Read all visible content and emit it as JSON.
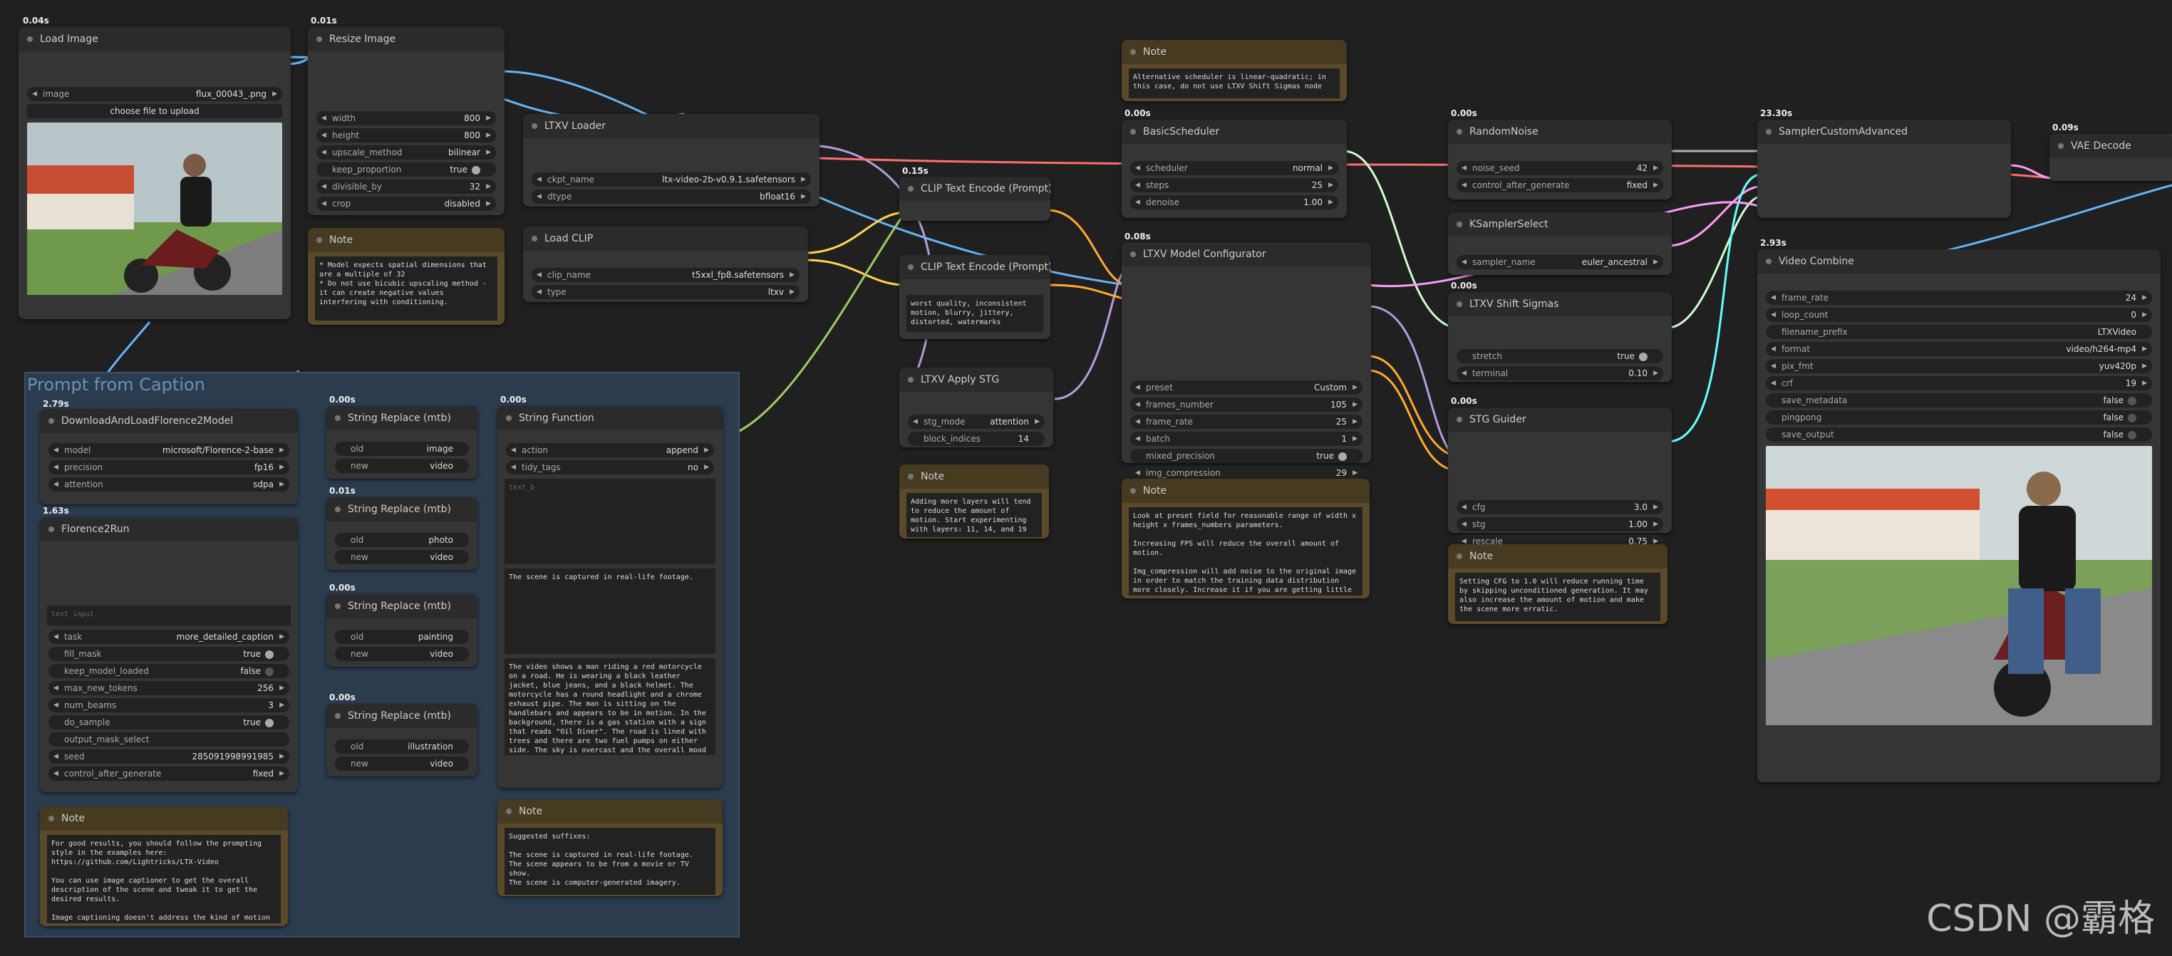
{
  "group": {
    "title": "Prompt from Caption"
  },
  "nodes": {
    "load_image": {
      "time": "0.04s",
      "title": "Load Image",
      "image_label": "image",
      "image_value": "flux_00043_.png",
      "upload": "choose file to upload"
    },
    "resize_image": {
      "time": "0.01s",
      "title": "Resize Image",
      "widgets": [
        [
          "width",
          "800"
        ],
        [
          "height",
          "800"
        ],
        [
          "upscale_method",
          "bilinear"
        ],
        [
          "keep_proportion",
          "true"
        ],
        [
          "divisible_by",
          "32"
        ],
        [
          "crop",
          "disabled"
        ]
      ]
    },
    "note_resize": {
      "title": "Note",
      "text": "* Model expects spatial dimensions that are a multiple of 32\n* Do not use bicubic upscaling method - it can create negative values interfering with conditioning."
    },
    "ltxv_loader": {
      "title": "LTXV Loader",
      "widgets": [
        [
          "ckpt_name",
          "ltx-video-2b-v0.9.1.safetensors"
        ],
        [
          "dtype",
          "bfloat16"
        ]
      ]
    },
    "load_clip": {
      "title": "Load CLIP",
      "widgets": [
        [
          "clip_name",
          "t5xxl_fp8.safetensors"
        ],
        [
          "type",
          "ltxv"
        ]
      ]
    },
    "clip_pos": {
      "time": "0.15s",
      "title": "CLIP Text Encode (Prompt)"
    },
    "clip_neg": {
      "title": "CLIP Text Encode (Prompt)",
      "text": "worst quality, inconsistent motion, blurry, jittery, distorted, watermarks"
    },
    "apply_stg": {
      "title": "LTXV Apply STG",
      "widgets": [
        [
          "stg_mode",
          "attention"
        ],
        [
          "block_indices",
          "14"
        ]
      ]
    },
    "note_stg": {
      "title": "Note",
      "text": "Adding more layers will tend to reduce the amount of motion. Start experimenting with layers: 11, 14, and 19"
    },
    "note_sched": {
      "title": "Note",
      "text": "Alternative scheduler is linear-quadratic; in this case, do not use LTXV Shift Sigmas node"
    },
    "basic_sched": {
      "time": "0.00s",
      "title": "BasicScheduler",
      "widgets": [
        [
          "scheduler",
          "normal"
        ],
        [
          "steps",
          "25"
        ],
        [
          "denoise",
          "1.00"
        ]
      ]
    },
    "model_config": {
      "time": "0.08s",
      "title": "LTXV Model Configurator",
      "widgets": [
        [
          "preset",
          "Custom"
        ],
        [
          "frames_number",
          "105"
        ],
        [
          "frame_rate",
          "25"
        ],
        [
          "batch",
          "1"
        ],
        [
          "mixed_precision",
          "true"
        ],
        [
          "img_compression",
          "29"
        ]
      ]
    },
    "note_config": {
      "title": "Note",
      "text": "Look at preset field for reasonable range of width x height x frames_numbers parameters.\n\nIncreasing FPS will reduce the overall amount of motion.\n\nImg_compression will add noise to the original image in order to match the training data distribution more closely. Increase it if you are getting little motion in the resulting video."
    },
    "random_noise": {
      "time": "0.00s",
      "title": "RandomNoise",
      "widgets": [
        [
          "noise_seed",
          "42"
        ],
        [
          "control_after_generate",
          "fixed"
        ]
      ]
    },
    "ksampler_select": {
      "title": "KSamplerSelect",
      "widgets": [
        [
          "sampler_name",
          "euler_ancestral"
        ]
      ]
    },
    "shift_sigmas": {
      "time": "0.00s",
      "title": "LTXV Shift Sigmas",
      "widgets": [
        [
          "stretch",
          "true"
        ],
        [
          "terminal",
          "0.10"
        ]
      ]
    },
    "stg_guider": {
      "time": "0.00s",
      "title": "STG Guider",
      "widgets": [
        [
          "cfg",
          "3.0"
        ],
        [
          "stg",
          "1.00"
        ],
        [
          "rescale",
          "0.75"
        ]
      ]
    },
    "note_guider": {
      "title": "Note",
      "text": "Setting CFG to 1.0 will reduce running time by skipping unconditioned generation. It may also increase the amount of motion and make the scene more erratic."
    },
    "sampler_adv": {
      "time": "23.30s",
      "title": "SamplerCustomAdvanced"
    },
    "vae_decode": {
      "time": "0.09s",
      "title": "VAE Decode"
    },
    "video_combine": {
      "time": "2.93s",
      "title": "Video Combine",
      "widgets": [
        [
          "frame_rate",
          "24"
        ],
        [
          "loop_count",
          "0"
        ],
        [
          "filename_prefix",
          "LTXVideo"
        ],
        [
          "format",
          "video/h264-mp4"
        ],
        [
          "pix_fmt",
          "yuv420p"
        ],
        [
          "crf",
          "19"
        ],
        [
          "save_metadata",
          "false"
        ],
        [
          "pingpong",
          "false"
        ],
        [
          "save_output",
          "false"
        ]
      ]
    },
    "download_florence": {
      "time": "2.79s",
      "title": "DownloadAndLoadFlorence2Model",
      "widgets": [
        [
          "model",
          "microsoft/Florence-2-base"
        ],
        [
          "precision",
          "fp16"
        ],
        [
          "attention",
          "sdpa"
        ]
      ]
    },
    "florence_run": {
      "time": "1.63s",
      "title": "Florence2Run",
      "placeholder": "text_input",
      "widgets": [
        [
          "task",
          "more_detailed_caption"
        ],
        [
          "fill_mask",
          "true"
        ],
        [
          "keep_model_loaded",
          "false"
        ],
        [
          "max_new_tokens",
          "256"
        ],
        [
          "num_beams",
          "3"
        ],
        [
          "do_sample",
          "true"
        ],
        [
          "output_mask_select",
          ""
        ],
        [
          "seed",
          "285091998991985"
        ],
        [
          "control_after_generate",
          "fixed"
        ]
      ]
    },
    "note_florence": {
      "title": "Note",
      "text": "For good results, you should follow the prompting style in the examples here:\nhttps://github.com/Lightricks/LTX-Video\n\nYou can use image captioner to get the overall description of the scene and tweak it to get the desired results.\n\nImage captioning doesn't address the kind of motion"
    },
    "sr1": {
      "time": "0.00s",
      "title": "String Replace (mtb)",
      "old": "image",
      "new": "video"
    },
    "sr2": {
      "time": "0.01s",
      "title": "String Replace (mtb)",
      "old": "photo",
      "new": "video"
    },
    "sr3": {
      "time": "0.00s",
      "title": "String Replace (mtb)",
      "old": "painting",
      "new": "video"
    },
    "sr4": {
      "time": "0.00s",
      "title": "String Replace (mtb)",
      "old": "illustration",
      "new": "video"
    },
    "string_func": {
      "time": "0.00s",
      "title": "String Function",
      "widgets": [
        [
          "action",
          "append"
        ],
        [
          "tidy_tags",
          "no"
        ]
      ],
      "placeholder": "text_b",
      "suffix": "The scene is captured in real-life footage.",
      "output": "The video shows a man riding a red motorcycle on a road. He is wearing a black leather jacket, blue jeans, and a black helmet. The motorcycle has a round headlight and a chrome exhaust pipe. The man is sitting on the handlebars and appears to be in motion. In the background, there is a gas station with a sign that reads \"Oil Diner\". The road is lined with trees and there are two fuel pumps on either side. The sky is overcast and the overall mood of the video is somber.The"
    },
    "note_suffix": {
      "title": "Note",
      "text": "Suggested suffixes:\n\nThe scene is captured in real-life footage.\nThe scene appears to be from a movie or TV show.\nThe scene is computer-generated imagery."
    }
  },
  "labels": {
    "old": "old",
    "new": "new"
  },
  "watermark": "CSDN @霸格",
  "colors": {
    "model": "#b39ddb",
    "clip": "#ffd54f",
    "conditioning": "#ffa931",
    "image": "#64b5f6",
    "latent": "#ff9cf9",
    "noise": "#b0b0b0",
    "sigmas": "#cdffcd",
    "guider": "#66ffff",
    "string": "#77dd77"
  }
}
